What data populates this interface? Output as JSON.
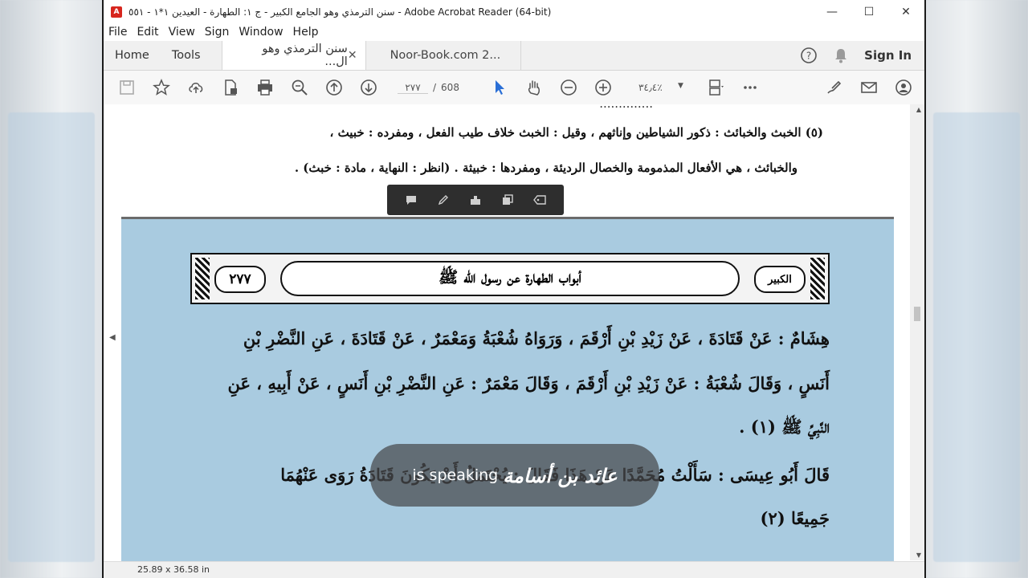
{
  "window": {
    "title": "سنن الترمذي وهو الجامع الكبير - ج ١: الطهارة - العيدين ١*١ - ٥٥١ - Adobe Acrobat Reader (64-bit)",
    "app_icon": "pdf-icon"
  },
  "menu": [
    "File",
    "Edit",
    "View",
    "Sign",
    "Window",
    "Help"
  ],
  "tabs": {
    "home": "Home",
    "tools": "Tools",
    "doc1": "سنن الترمذي وهو ال...",
    "doc2": "Noor-Book.com  2...",
    "sign_in": "Sign In"
  },
  "toolbar": {
    "page_current": "٢٧٧",
    "page_sep": "/",
    "page_total": "608",
    "zoom": "٣٤٫٤٪"
  },
  "page_prev": {
    "fn_line1": "(٥) الخبث والخبائث : ذكور الشياطين وإناثهم ، وقيل : الخبث خلاف طيب الفعل ، ومفرده : خبيث ،",
    "fn_line2": "والخبائث ، هي الأفعال المذمومة والخصال الرديئة ، ومفردها : خبيثة . (انظر : النهاية ، مادة : خبث) ."
  },
  "page_main": {
    "header_title": "أبواب الطهارة عن رسول الله ﷺ",
    "page_number": "٢٧٧",
    "book_label": "الكبير",
    "line1": "هِشَامٌ : عَنْ قَتَادَةَ ، عَنْ زَيْدِ بْنِ أَرْقَمَ ، وَرَوَاهُ شُعْبَةُ وَمَعْمَرٌ ، عَنْ قَتَادَةَ ، عَنِ النَّضْرِ بْنِ",
    "line2": "أَنَسٍ ، وَقَالَ شُعْبَةُ : عَنْ زَيْدِ بْنِ أَرْقَمَ ، وَقَالَ مَعْمَرٌ : عَنِ النَّضْرِ بْنِ أَنَسٍ ، عَنْ أَبِيهِ ، عَنِ",
    "line3": "النَّبِيِّ ﷺ (١) .",
    "line4": "قَالَ أَبُو عِيسَى : سَأَلْتُ مُحَمَّدًا عَنْ هَذَا فَقَالَ : يُحْتَمَلُ أَنْ يَكُونَ قَتَادَةُ رَوَى عَنْهُمَا",
    "line5": "جَمِيعًا (٢)"
  },
  "statusbar": {
    "page_size": "25.89 x 36.58 in"
  },
  "caption": {
    "speaker": "عائد بن أسامة",
    "text": "is speaking"
  }
}
